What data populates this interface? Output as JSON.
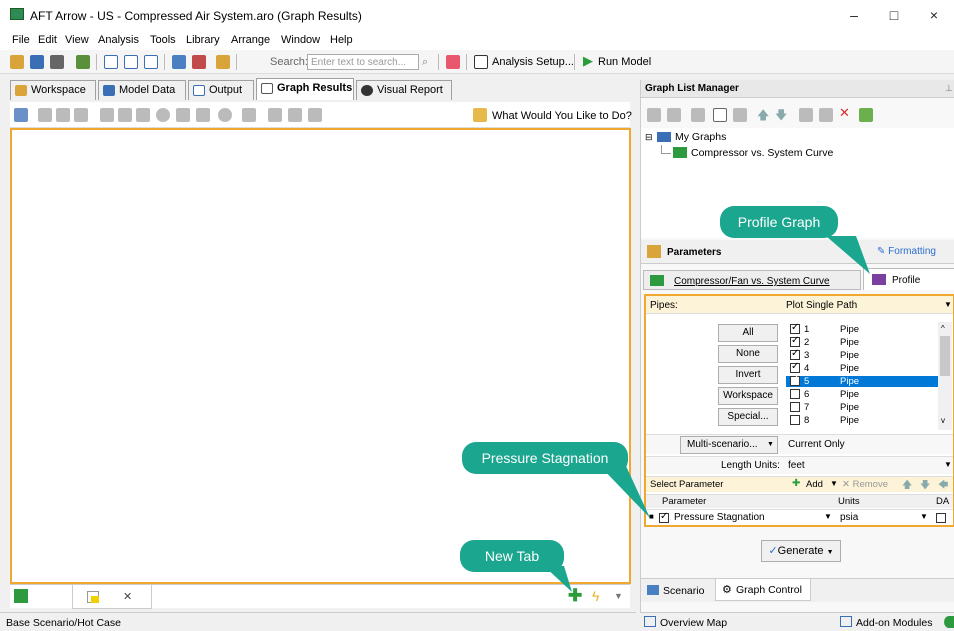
{
  "window": {
    "title": "AFT Arrow - US - Compressed Air System.aro (Graph Results)",
    "min": "–",
    "max": "□",
    "close": "×"
  },
  "menu": [
    "File",
    "Edit",
    "View",
    "Analysis",
    "Tools",
    "Library",
    "Arrange",
    "Window",
    "Help"
  ],
  "toolbar": {
    "search_label": "Search:",
    "search_placeholder": "Enter text to search...",
    "analysis_setup": "Analysis Setup...",
    "run_model": "Run Model"
  },
  "tabs": [
    "Workspace",
    "Model Data",
    "Output",
    "Graph Results",
    "Visual Report"
  ],
  "graph_toolbar": {
    "what_would": "What Would You Like to Do?"
  },
  "graph_list": {
    "header": "Graph List Manager",
    "root": "My Graphs",
    "item": "Compressor vs. System Curve"
  },
  "parameters": {
    "header": "Parameters",
    "formatting": "Formatting",
    "tab1": "Compressor/Fan vs. System Curve",
    "tab2": "Profile"
  },
  "pipes": {
    "label": "Pipes:",
    "mode": "Plot Single Path",
    "buttons": [
      "All",
      "None",
      "Invert",
      "Workspace",
      "Special..."
    ],
    "rows": [
      {
        "num": "1",
        "name": "Pipe",
        "checked": true
      },
      {
        "num": "2",
        "name": "Pipe",
        "checked": true
      },
      {
        "num": "3",
        "name": "Pipe",
        "checked": true
      },
      {
        "num": "4",
        "name": "Pipe",
        "checked": true
      },
      {
        "num": "5",
        "name": "Pipe",
        "checked": true
      },
      {
        "num": "6",
        "name": "Pipe",
        "checked": false
      },
      {
        "num": "7",
        "name": "Pipe",
        "checked": false
      },
      {
        "num": "8",
        "name": "Pipe",
        "checked": false
      }
    ]
  },
  "multi": {
    "button": "Multi-scenario...",
    "value": "Current Only"
  },
  "length": {
    "label": "Length Units:",
    "value": "feet"
  },
  "select_param": {
    "label": "Select Parameter",
    "add": "Add",
    "remove": "Remove",
    "col_param": "Parameter",
    "col_units": "Units",
    "col_da": "DA",
    "row_param": "Pressure Stagnation",
    "row_units": "psia"
  },
  "generate": "Generate",
  "bottom_right_tabs": {
    "scenario": "Scenario",
    "graph_control": "Graph Control"
  },
  "status": {
    "scenario": "Base Scenario/Hot Case",
    "overview": "Overview Map",
    "addon": "Add-on Modules"
  },
  "callouts": {
    "profile": "Profile Graph",
    "pressure": "Pressure Stagnation",
    "newtab": "New Tab"
  },
  "colors": {
    "callout": "#1aa68f",
    "highlight": "#f0a830",
    "selected_row": "#0078d7"
  }
}
